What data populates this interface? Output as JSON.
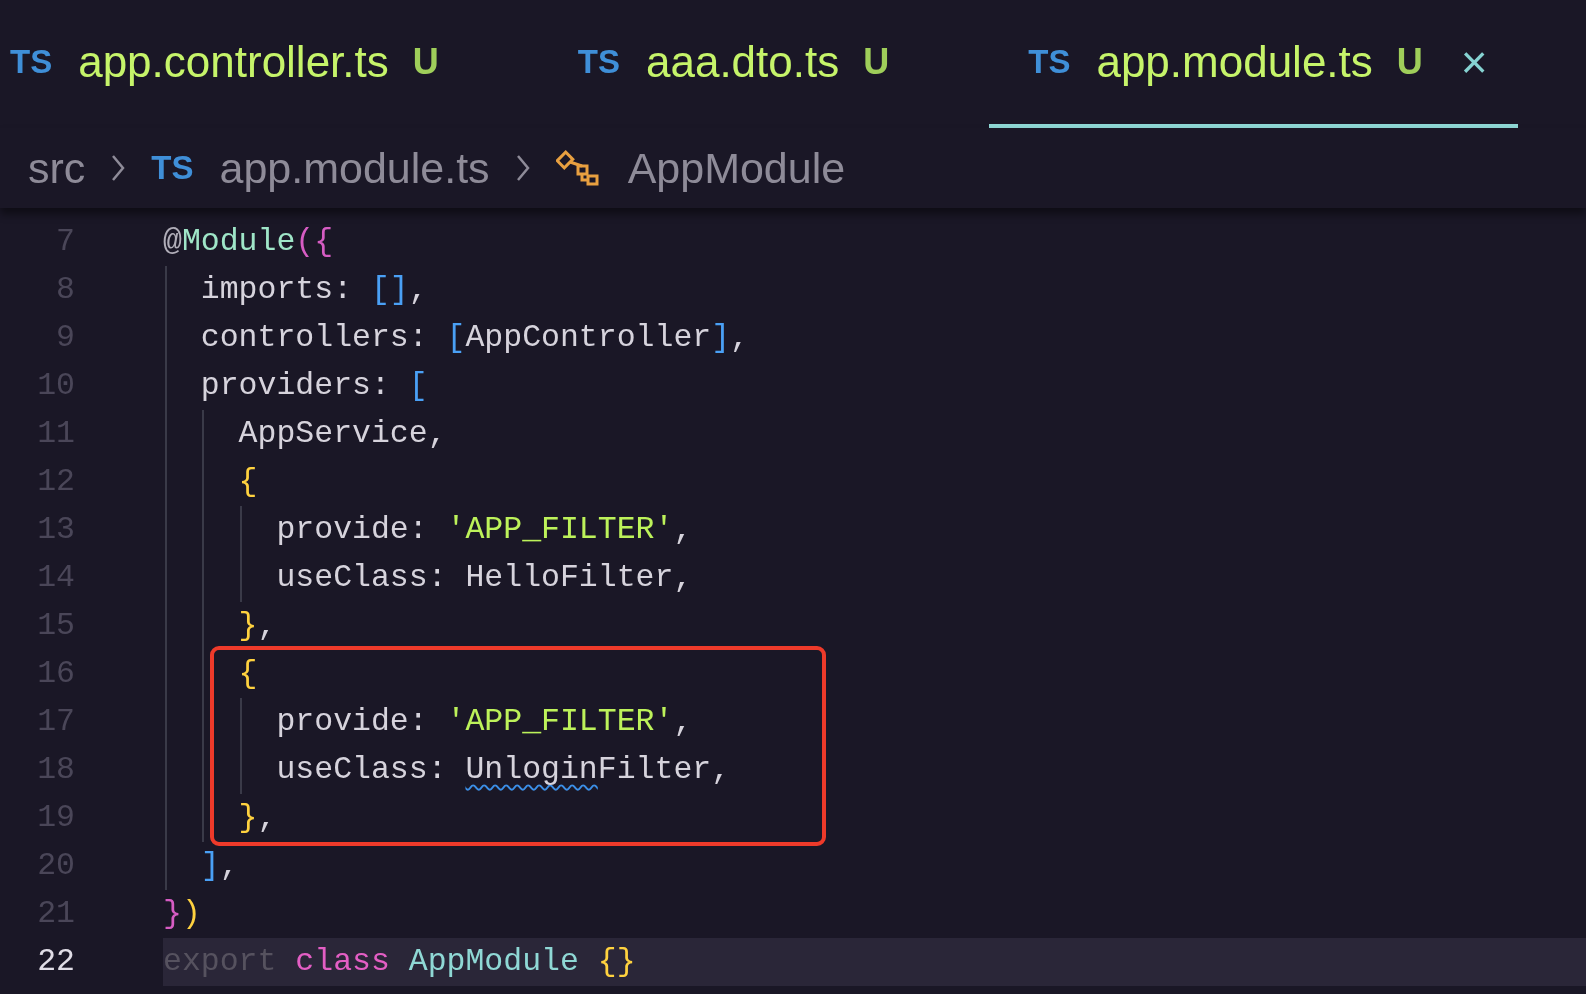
{
  "tabs": [
    {
      "icon": "TS",
      "label": "app.controller.ts",
      "badge": "U",
      "selected": false
    },
    {
      "icon": "TS",
      "label": "aaa.dto.ts",
      "badge": "U",
      "selected": false
    },
    {
      "icon": "TS",
      "label": "app.module.ts",
      "badge": "U",
      "selected": true,
      "close": "×"
    }
  ],
  "breadcrumb": [
    {
      "kind": "folder",
      "label": "src"
    },
    {
      "kind": "file",
      "icon": "TS",
      "label": "app.module.ts"
    },
    {
      "kind": "symbol",
      "label": "AppModule"
    }
  ],
  "code_lines": [
    {
      "number": "7",
      "current": false,
      "highlight": false,
      "tokens": [
        {
          "text": "@",
          "kind": "at"
        },
        {
          "text": "Module",
          "kind": "decorator"
        },
        {
          "text": "({",
          "kind": "pink"
        }
      ]
    },
    {
      "number": "8",
      "current": false,
      "highlight": false,
      "tokens": [
        {
          "text": "  imports: ",
          "kind": "plain"
        },
        {
          "text": "[]",
          "kind": "bracket"
        },
        {
          "text": ",",
          "kind": "plain"
        }
      ]
    },
    {
      "number": "9",
      "current": false,
      "highlight": false,
      "tokens": [
        {
          "text": "  controllers: ",
          "kind": "plain"
        },
        {
          "text": "[",
          "kind": "bracket"
        },
        {
          "text": "AppController",
          "kind": "plain"
        },
        {
          "text": "]",
          "kind": "bracket"
        },
        {
          "text": ",",
          "kind": "plain"
        }
      ]
    },
    {
      "number": "10",
      "current": false,
      "highlight": false,
      "tokens": [
        {
          "text": "  providers: ",
          "kind": "plain"
        },
        {
          "text": "[",
          "kind": "bracket"
        }
      ]
    },
    {
      "number": "11",
      "current": false,
      "highlight": false,
      "tokens": [
        {
          "text": "    AppService,",
          "kind": "plain"
        }
      ]
    },
    {
      "number": "12",
      "current": false,
      "highlight": false,
      "tokens": [
        {
          "text": "    {",
          "kind": "brace"
        }
      ]
    },
    {
      "number": "13",
      "current": false,
      "highlight": false,
      "tokens": [
        {
          "text": "      provide: ",
          "kind": "plain"
        },
        {
          "text": "'APP_FILTER'",
          "kind": "string"
        },
        {
          "text": ",",
          "kind": "plain"
        }
      ]
    },
    {
      "number": "14",
      "current": false,
      "highlight": false,
      "tokens": [
        {
          "text": "      useClass: HelloFilter,",
          "kind": "plain"
        }
      ]
    },
    {
      "number": "15",
      "current": false,
      "highlight": false,
      "tokens": [
        {
          "text": "    }",
          "kind": "brace"
        },
        {
          "text": ",",
          "kind": "plain"
        }
      ]
    },
    {
      "number": "16",
      "current": false,
      "highlight": true,
      "tokens": [
        {
          "text": "    {",
          "kind": "brace"
        }
      ]
    },
    {
      "number": "17",
      "current": false,
      "highlight": true,
      "tokens": [
        {
          "text": "      provide: ",
          "kind": "plain"
        },
        {
          "text": "'APP_FILTER'",
          "kind": "string"
        },
        {
          "text": ",",
          "kind": "plain"
        }
      ]
    },
    {
      "number": "18",
      "current": false,
      "highlight": true,
      "tokens": [
        {
          "text": "      useClass: ",
          "kind": "plain"
        },
        {
          "text": "Unlogin",
          "kind": "error"
        },
        {
          "text": "Filter,",
          "kind": "plain"
        }
      ]
    },
    {
      "number": "19",
      "current": false,
      "highlight": true,
      "tokens": [
        {
          "text": "    }",
          "kind": "brace"
        },
        {
          "text": ",",
          "kind": "plain"
        }
      ]
    },
    {
      "number": "20",
      "current": false,
      "highlight": false,
      "tokens": [
        {
          "text": "  ]",
          "kind": "bracket"
        },
        {
          "text": ",",
          "kind": "plain"
        }
      ]
    },
    {
      "number": "21",
      "current": false,
      "highlight": false,
      "tokens": [
        {
          "text": "}",
          "kind": "pink"
        },
        {
          "text": ")",
          "kind": "brace"
        }
      ]
    },
    {
      "number": "22",
      "current": true,
      "highlight": false,
      "tokens": [
        {
          "text": "export",
          "kind": "faded"
        },
        {
          "text": " class",
          "kind": "keyword"
        },
        {
          "text": " AppModule",
          "kind": "type"
        },
        {
          "text": " {}",
          "kind": "brace"
        }
      ]
    }
  ]
}
